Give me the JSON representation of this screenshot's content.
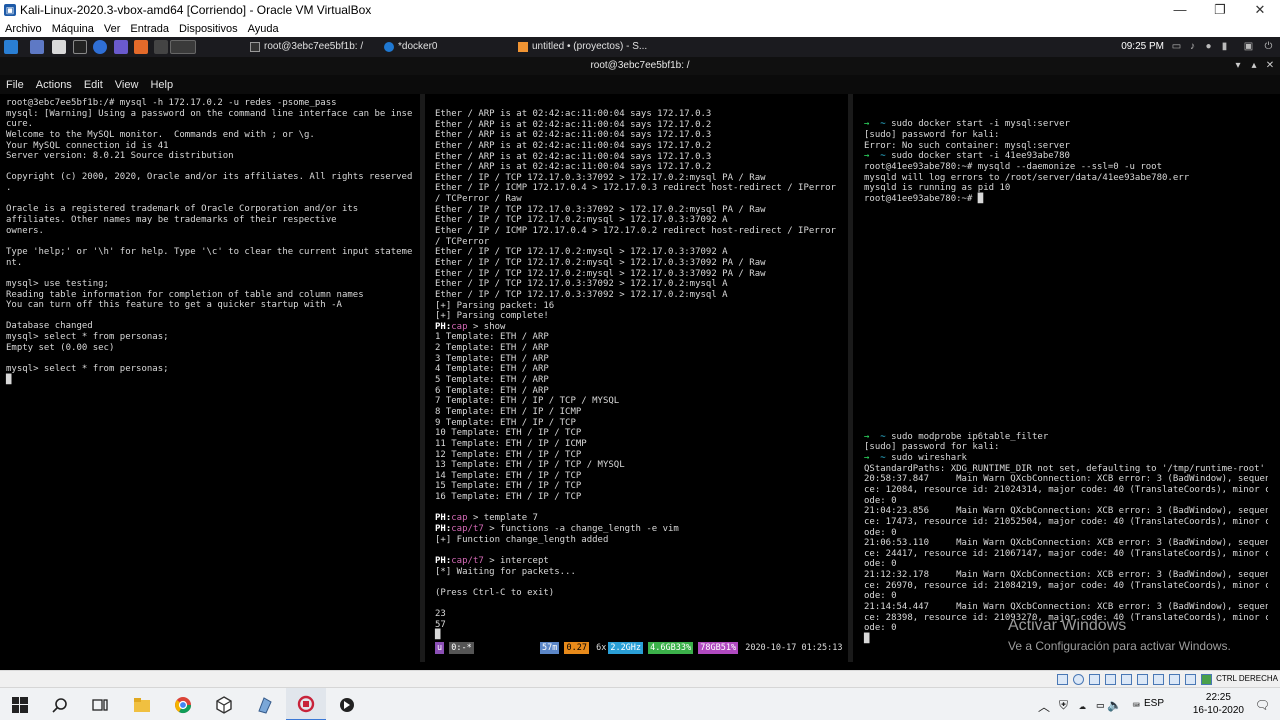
{
  "vbox": {
    "title": "Kali-Linux-2020.3-vbox-amd64 [Corriendo] - Oracle VM VirtualBox",
    "menu": [
      "Archivo",
      "Máquina",
      "Ver",
      "Entrada",
      "Dispositivos",
      "Ayuda"
    ],
    "host_key": "CTRL DERECHA"
  },
  "kali_panel": {
    "tasks": [
      "root@3ebc7ee5bf1b: /",
      "*docker0",
      "untitled • (proyectos) - S..."
    ],
    "clock": "09:25 PM"
  },
  "terminal": {
    "title": "root@3ebc7ee5bf1b: /",
    "menu": [
      "File",
      "Actions",
      "Edit",
      "View",
      "Help"
    ]
  },
  "pane_left": [
    "root@3ebc7ee5bf1b:/# mysql -h 172.17.0.2 -u redes -psome_pass",
    "mysql: [Warning] Using a password on the command line interface can be inse",
    "cure.",
    "Welcome to the MySQL monitor.  Commands end with ; or \\g.",
    "Your MySQL connection id is 41",
    "Server version: 8.0.21 Source distribution",
    "",
    "Copyright (c) 2000, 2020, Oracle and/or its affiliates. All rights reserved",
    ".",
    "",
    "Oracle is a registered trademark of Oracle Corporation and/or its",
    "affiliates. Other names may be trademarks of their respective",
    "owners.",
    "",
    "Type 'help;' or '\\h' for help. Type '\\c' to clear the current input stateme",
    "nt.",
    "",
    "mysql> use testing;",
    "Reading table information for completion of table and column names",
    "You can turn off this feature to get a quicker startup with -A",
    "",
    "Database changed",
    "mysql> select * from personas;",
    "Empty set (0.00 sec)",
    "",
    "mysql> select * from personas;",
    "█"
  ],
  "pane_mid": [
    "Ether / ARP is at 02:42:ac:11:00:04 says 172.17.0.3",
    "Ether / ARP is at 02:42:ac:11:00:04 says 172.17.0.2",
    "Ether / ARP is at 02:42:ac:11:00:04 says 172.17.0.3",
    "Ether / ARP is at 02:42:ac:11:00:04 says 172.17.0.2",
    "Ether / ARP is at 02:42:ac:11:00:04 says 172.17.0.3",
    "Ether / ARP is at 02:42:ac:11:00:04 says 172.17.0.2",
    "Ether / IP / TCP 172.17.0.3:37092 > 172.17.0.2:mysql PA / Raw",
    "Ether / IP / ICMP 172.17.0.4 > 172.17.0.3 redirect host-redirect / IPerror",
    "/ TCPerror / Raw",
    "Ether / IP / TCP 172.17.0.3:37092 > 172.17.0.2:mysql PA / Raw",
    "Ether / IP / TCP 172.17.0.2:mysql > 172.17.0.3:37092 A",
    "Ether / IP / ICMP 172.17.0.4 > 172.17.0.2 redirect host-redirect / IPerror",
    "/ TCPerror",
    "Ether / IP / TCP 172.17.0.2:mysql > 172.17.0.3:37092 A",
    "Ether / IP / TCP 172.17.0.2:mysql > 172.17.0.3:37092 PA / Raw",
    "Ether / IP / TCP 172.17.0.2:mysql > 172.17.0.3:37092 PA / Raw",
    "Ether / IP / TCP 172.17.0.3:37092 > 172.17.0.2:mysql A",
    "Ether / IP / TCP 172.17.0.3:37092 > 172.17.0.2:mysql A",
    "[+] Parsing packet: 16",
    "[+] Parsing complete!",
    "PH:cap > show",
    "1 Template: ETH / ARP",
    "2 Template: ETH / ARP",
    "3 Template: ETH / ARP",
    "4 Template: ETH / ARP",
    "5 Template: ETH / ARP",
    "6 Template: ETH / ARP",
    "7 Template: ETH / IP / TCP / MYSQL",
    "8 Template: ETH / IP / ICMP",
    "9 Template: ETH / IP / TCP",
    "10 Template: ETH / IP / TCP",
    "11 Template: ETH / IP / ICMP",
    "12 Template: ETH / IP / TCP",
    "13 Template: ETH / IP / TCP / MYSQL",
    "14 Template: ETH / IP / TCP",
    "15 Template: ETH / IP / TCP",
    "16 Template: ETH / IP / TCP",
    "",
    "PH:cap > template 7",
    "PH:cap/t7 > functions -a change_length -e vim",
    "[+] Function change_length added",
    "",
    "PH:cap/t7 > intercept",
    "[*] Waiting for packets...",
    "",
    "(Press Ctrl-C to exit)",
    "",
    "23",
    "57",
    "█"
  ],
  "pane_right_top": [
    "→  ~ sudo docker start -i mysql:server",
    "[sudo] password for kali:",
    "Error: No such container: mysql:server",
    "→  ~ sudo docker start -i 41ee93abe780",
    "root@41ee93abe780:~# mysqld --daemonize --ssl=0 -u root",
    "mysqld will log errors to /root/server/data/41ee93abe780.err",
    "mysqld is running as pid 10",
    "root@41ee93abe780:~# █"
  ],
  "pane_right_bottom": [
    "→  ~ sudo modprobe ip6table_filter",
    "[sudo] password for kali:",
    "→  ~ sudo wireshark",
    "QStandardPaths: XDG_RUNTIME_DIR not set, defaulting to '/tmp/runtime-root'",
    "20:58:37.847     Main Warn QXcbConnection: XCB error: 3 (BadWindow), sequen",
    "ce: 12084, resource id: 21024314, major code: 40 (TranslateCoords), minor c",
    "ode: 0",
    "21:04:23.856     Main Warn QXcbConnection: XCB error: 3 (BadWindow), sequen",
    "ce: 17473, resource id: 21052504, major code: 40 (TranslateCoords), minor c",
    "ode: 0",
    "21:06:53.110     Main Warn QXcbConnection: XCB error: 3 (BadWindow), sequen",
    "ce: 24417, resource id: 21067147, major code: 40 (TranslateCoords), minor c",
    "ode: 0",
    "21:12:32.178     Main Warn QXcbConnection: XCB error: 3 (BadWindow), sequen",
    "ce: 26970, resource id: 21084219, major code: 40 (TranslateCoords), minor c",
    "ode: 0",
    "21:14:54.447     Main Warn QXcbConnection: XCB error: 3 (BadWindow), sequen",
    "ce: 28398, resource id: 21093270, major code: 40 (TranslateCoords), minor c",
    "ode: 0",
    "█"
  ],
  "status_bar": {
    "seg1": "u",
    "seg2": "0:-*",
    "seg3": "57m",
    "seg4": "0.27",
    "seg5": "6x",
    "seg6": "2.2GHz",
    "seg7": "4.6GB33%",
    "seg8": "78GB51%",
    "datetime": "2020-10-17 01:25:13"
  },
  "watermark": {
    "title": "Activar Windows",
    "subtitle": "Ve a Configuración para activar Windows."
  },
  "taskbar": {
    "lang": "ESP",
    "time": "22:25",
    "date": "16-10-2020"
  },
  "colors": {
    "green": "#2ee062",
    "red": "#e0424c",
    "taskbar": "#f0f2f4"
  }
}
